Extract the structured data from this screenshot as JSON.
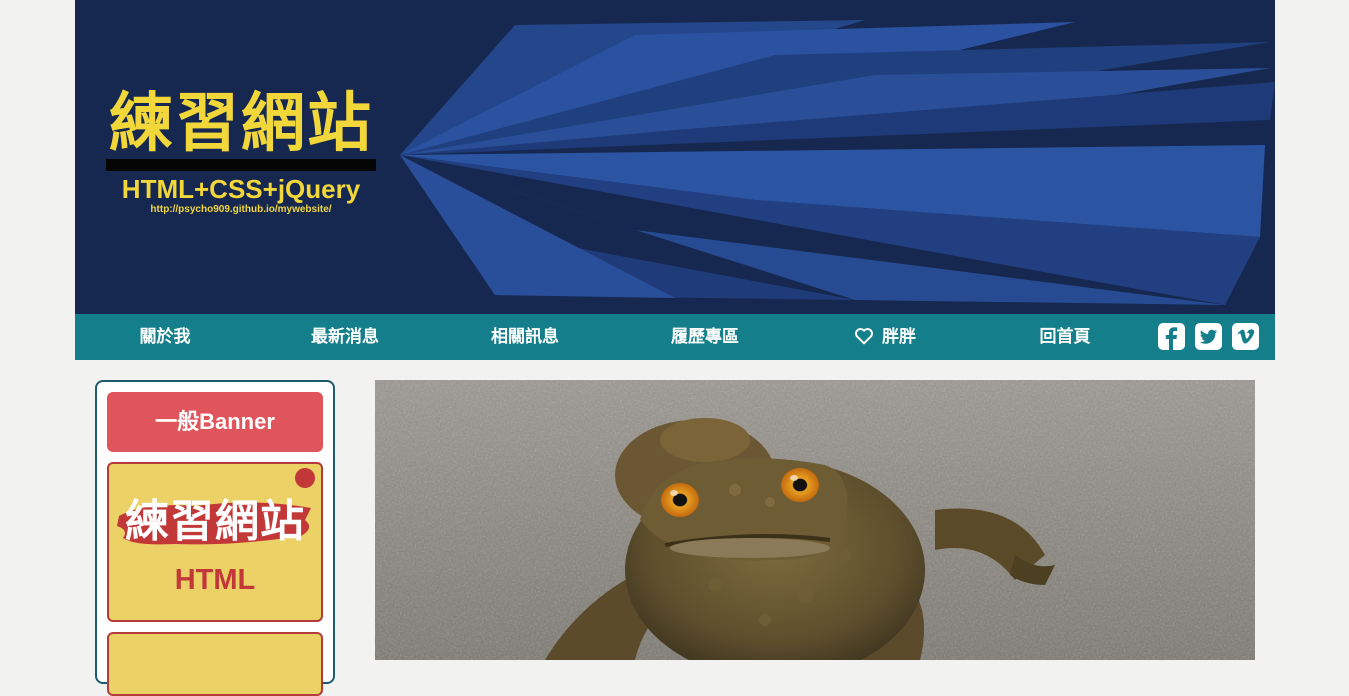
{
  "header": {
    "logo_title": "練習網站",
    "logo_subtitle": "HTML+CSS+jQuery",
    "logo_url": "http://psycho909.github.io/mywebsite/"
  },
  "nav": {
    "items": [
      {
        "label": "關於我"
      },
      {
        "label": "最新消息"
      },
      {
        "label": "相關訊息"
      },
      {
        "label": "履歷專區"
      },
      {
        "label": "胖胖",
        "icon": "heart-icon"
      },
      {
        "label": "回首頁"
      }
    ],
    "social": [
      "facebook-icon",
      "twitter-icon",
      "vimeo-icon"
    ]
  },
  "sidebar": {
    "banner_button": "一般Banner",
    "card": {
      "title": "練習網站",
      "subtitle": "HTML"
    }
  },
  "colors": {
    "header_bg": "#16284f",
    "accent_yellow": "#f2d73a",
    "nav_bg": "#147f8a",
    "banner_red": "#e0555b",
    "card_yellow": "#ecd266"
  }
}
